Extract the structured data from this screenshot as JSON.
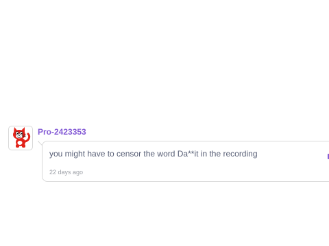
{
  "comment": {
    "username": "Pro-2423353",
    "avatar_icon": "scratch-cat-icon",
    "text": "you might have to censor the word Da**it in the recording",
    "timestamp": "22 days ago"
  },
  "colors": {
    "username": "#855cd6",
    "text": "#575e75",
    "timestamp": "#9ea1a8",
    "border": "#d9d9d9"
  }
}
